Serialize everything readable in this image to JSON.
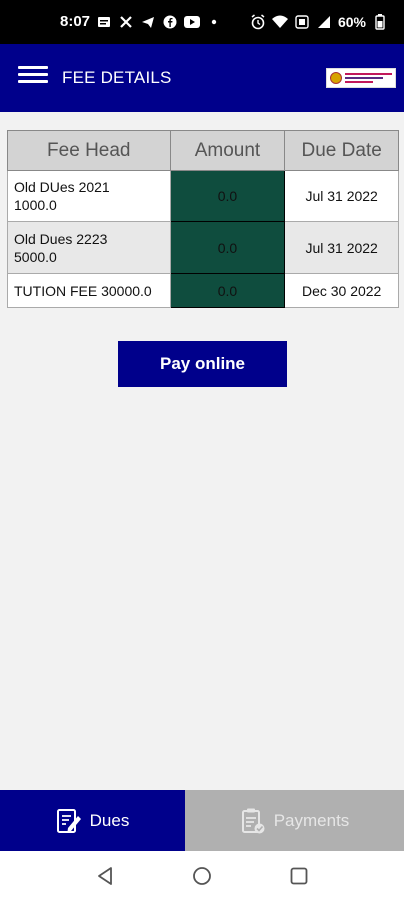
{
  "status_bar": {
    "time": "8:07",
    "battery": "60%"
  },
  "app_bar": {
    "title": "FEE DETAILS"
  },
  "table": {
    "headers": [
      "Fee Head",
      "Amount",
      "Due Date"
    ],
    "rows": [
      {
        "head_line1": "Old DUes 2021",
        "head_line2": "1000.0",
        "amount": "0.0",
        "due_date": "Jul 31 2022"
      },
      {
        "head_line1": "Old Dues 2223",
        "head_line2": "5000.0",
        "amount": "0.0",
        "due_date": "Jul 31 2022"
      },
      {
        "head_line1": "TUTION FEE 30000.0",
        "head_line2": "",
        "amount": "0.0",
        "due_date": "Dec 30 2022"
      }
    ]
  },
  "pay_button": {
    "label": "Pay online"
  },
  "tabs": [
    {
      "label": "Dues",
      "icon": "edit-document-icon",
      "active": true
    },
    {
      "label": "Payments",
      "icon": "clipboard-check-icon",
      "active": false
    }
  ],
  "colors": {
    "primary": "#00008b",
    "amount_cell": "#0f4d3e",
    "inactive_tab": "#b0b0b0"
  }
}
